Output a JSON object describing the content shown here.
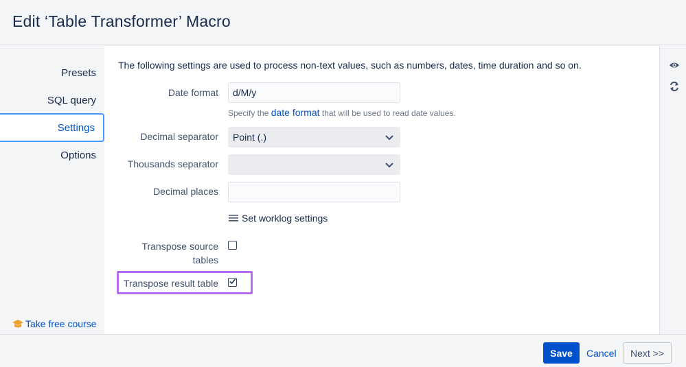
{
  "header": {
    "title": "Edit ‘Table Transformer’ Macro"
  },
  "sidebar": {
    "items": [
      {
        "label": "Presets"
      },
      {
        "label": "SQL query"
      },
      {
        "label": "Settings"
      },
      {
        "label": "Options"
      }
    ],
    "active": "Settings",
    "course_link": "Take free course",
    "accent_color": "#4c9aff"
  },
  "settings": {
    "intro": "The following settings are used to process non-text values, such as numbers, dates, time duration and so on.",
    "date_format": {
      "label": "Date format",
      "value": "d/M/y",
      "hint_prefix": "Specify the",
      "hint_link": "date format",
      "hint_suffix": "that will be used to read date values."
    },
    "decimal_separator": {
      "label": "Decimal separator",
      "value": "Point (.)"
    },
    "thousands_separator": {
      "label": "Thousands separator",
      "value": ""
    },
    "decimal_places": {
      "label": "Decimal places",
      "value": ""
    },
    "worklog_link": "Set worklog settings",
    "transpose_source": {
      "label_line1": "Transpose source",
      "label_line2": "tables",
      "checked": false
    },
    "transpose_result": {
      "label": "Transpose result table",
      "checked": true
    },
    "highlight_color": "#b46cf0"
  },
  "rail": {
    "icons": [
      "eye-icon",
      "refresh-icon"
    ]
  },
  "footer": {
    "save": "Save",
    "cancel": "Cancel",
    "next": "Next >>"
  }
}
